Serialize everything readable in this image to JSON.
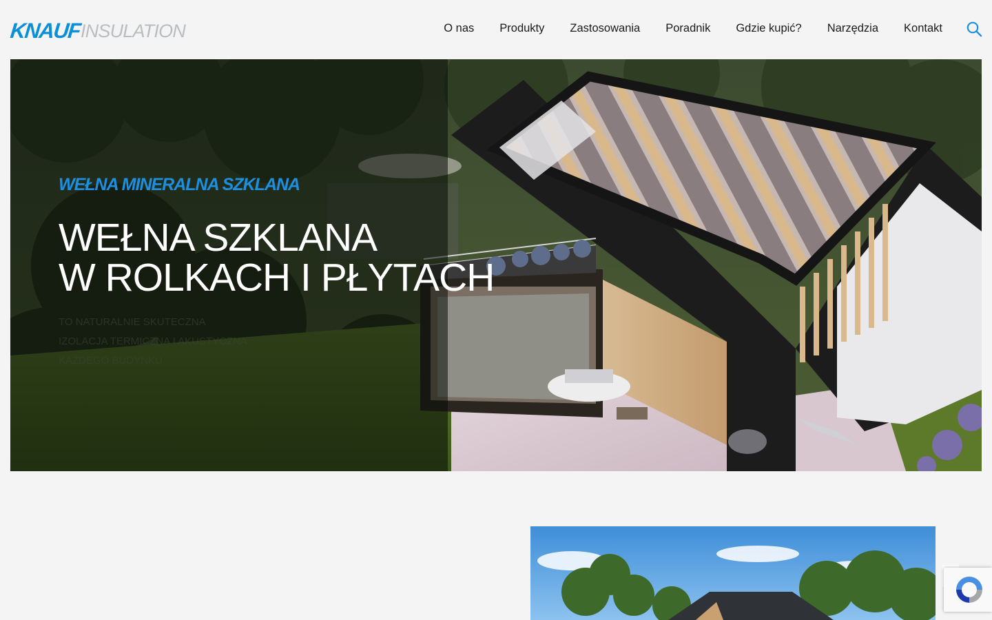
{
  "brand": {
    "logo_primary": "KNAUF",
    "logo_secondary": "INSULATION",
    "primary_color": "#0a8fd9",
    "secondary_color": "#b9bdc1"
  },
  "nav": {
    "items": [
      "O nas",
      "Produkty",
      "Zastosowania",
      "Poradnik",
      "Gdzie kupić?",
      "Narzędzia",
      "Kontakt"
    ],
    "search_icon": "search-icon"
  },
  "hero": {
    "eyebrow": "WEŁNA MINERALNA SZKLANA",
    "title_line1": "WEŁNA SZKLANA",
    "title_line2": "W ROLKACH I PŁYTACH",
    "subtitle_lines": [
      "TO NATURALNIE SKUTECZNA",
      "IZOLACJA TERMICZNA I AKUSTYCZNA",
      "KAŻDEGO BUDYNKU"
    ],
    "eyebrow_color": "#1d8fe0"
  },
  "recaptcha": {
    "icon": "recaptcha-icon"
  }
}
